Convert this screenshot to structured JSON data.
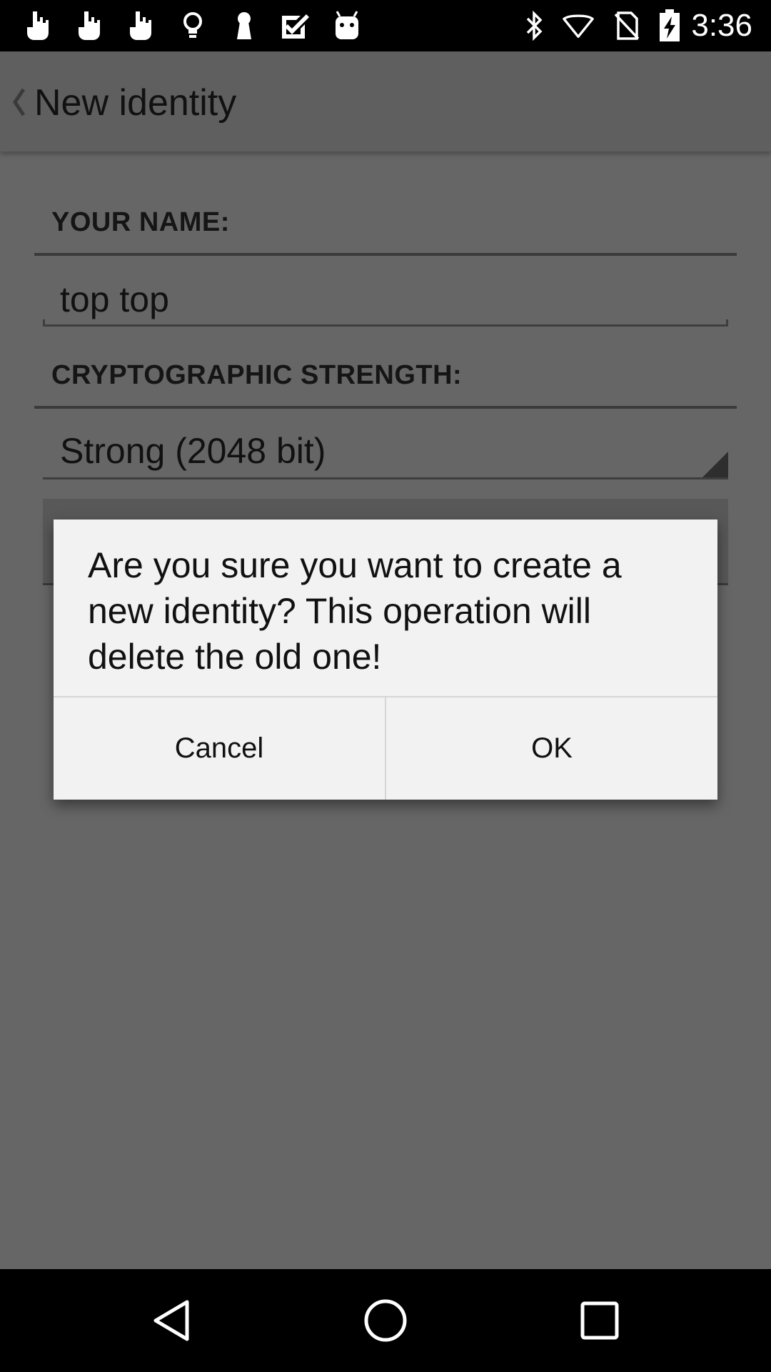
{
  "status_bar": {
    "left_icons": [
      "hand-pointer-icon",
      "hand-pointer-icon",
      "hand-pointer-icon",
      "lightbulb-icon",
      "keyhole-icon",
      "checkmark-box-icon",
      "android-icon"
    ],
    "right_icons": [
      "bluetooth-icon",
      "wifi-icon",
      "no-sim-icon",
      "battery-charging-icon"
    ],
    "time": "3:36"
  },
  "app_bar": {
    "back_icon": "chevron-left-icon",
    "title": "New identity"
  },
  "form": {
    "name_label": "YOUR NAME:",
    "name_value": "top top",
    "strength_label": "CRYPTOGRAPHIC STRENGTH:",
    "strength_value": "Strong (2048 bit)"
  },
  "dialog": {
    "message": "Are you sure you want to create a new identity? This operation will delete the old one!",
    "cancel_label": "Cancel",
    "ok_label": "OK"
  },
  "nav_bar": {
    "icons": [
      "back-triangle-icon",
      "home-circle-icon",
      "recents-square-icon"
    ]
  },
  "colors": {
    "scrim": "#666666",
    "dialog_bg": "#f2f2f2",
    "bars": "#000000"
  }
}
